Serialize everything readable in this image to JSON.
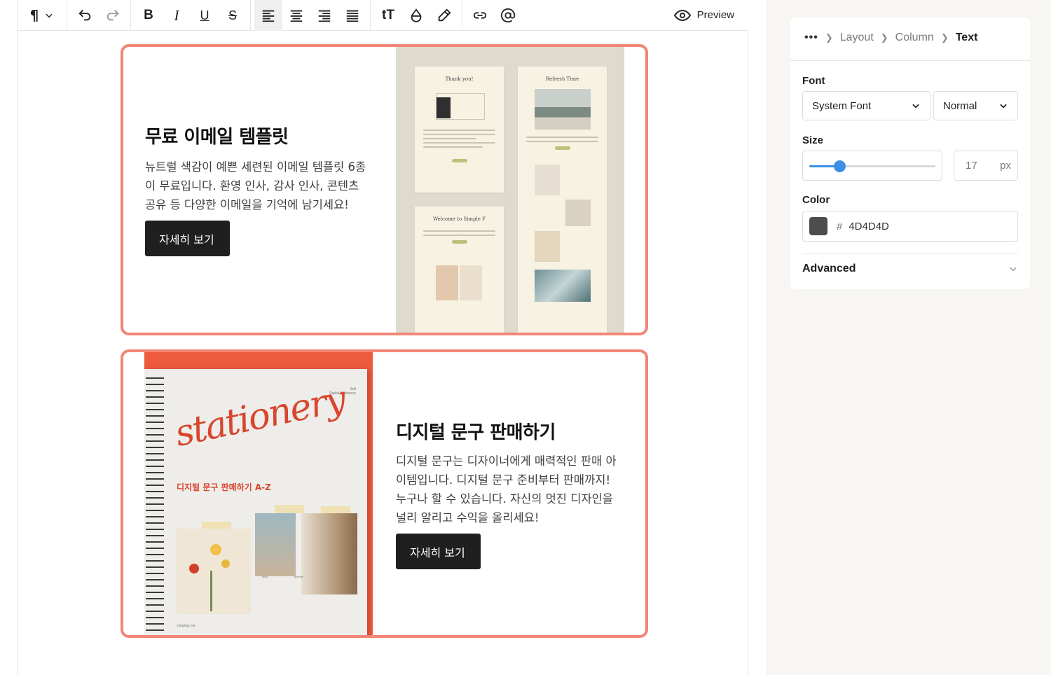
{
  "toolbar": {
    "paragraph_icon": "pilcrow-icon",
    "preview_label": "Preview"
  },
  "cards": [
    {
      "title": "무료 이메일 템플릿",
      "body_lines": [
        "뉴트럴 색감이 예쁜 세련된 이메일 템플릿 6종",
        "이 무료입니다. 환영 인사, 감사 인사, 콘텐츠",
        "공유 등 다양한 이메일을 기억에 남기세요!"
      ],
      "button_label": "자세히 보기",
      "mail_titles": [
        "Thank you!",
        "Refresh Time",
        "Welcome to Simple F"
      ]
    },
    {
      "title": "디지털 문구 판매하기",
      "body_lines": [
        "디지털 문구는 디자이너에게 매력적인 판매 아",
        "이템입니다. 디지털 문구 준비부터 판매까지!",
        "누구나 할 수 있습니다. 자신의 멋진 디자인을",
        "널리 알리고 수익을 올리세요!"
      ],
      "button_label": "자세히 보기",
      "notebook_script": "stationery",
      "notebook_subtitle": "디지털 문구 판매하기 A-Z",
      "notebook_corner": [
        "Sell",
        "Digital Stationery"
      ],
      "notebook_footer": "cimplepi.net",
      "notebook_captions": [
        "diary",
        "planner"
      ]
    }
  ],
  "panel": {
    "breadcrumb": [
      "Layout",
      "Column",
      "Text"
    ],
    "font_label": "Font",
    "font_family": "System Font",
    "font_weight": "Normal",
    "size_label": "Size",
    "size_value": "17",
    "size_unit": "px",
    "size_slider_fraction": 0.24,
    "color_label": "Color",
    "color_hex": "4D4D4D",
    "color_hash": "#",
    "advanced_label": "Advanced"
  },
  "colors": {
    "card_border": "#f18677",
    "swatch": "#4d4d4d",
    "accent": "#3b8fe6"
  }
}
